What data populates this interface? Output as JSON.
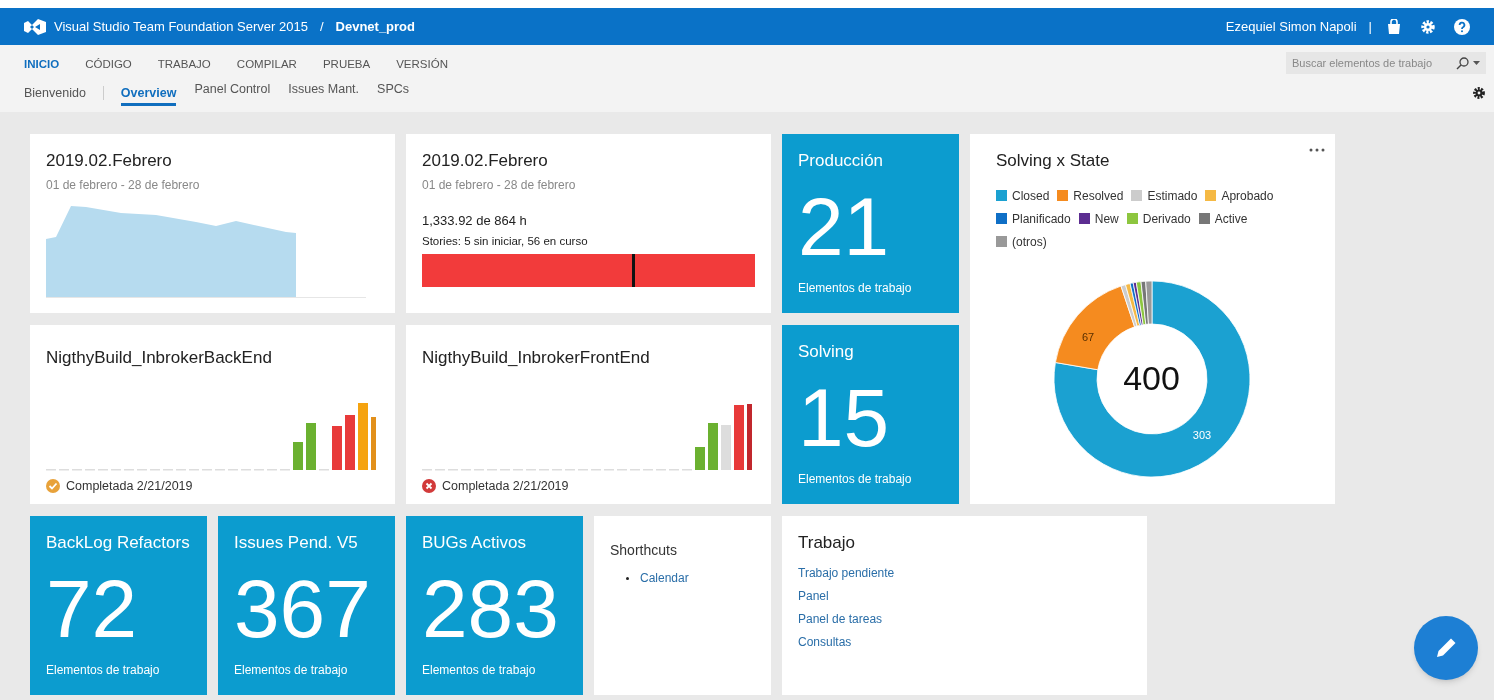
{
  "header": {
    "product": "Visual Studio Team Foundation Server 2015",
    "separator": "/",
    "project": "Devnet_prod",
    "user": "Ezequiel Simon Napoli",
    "divider": "|"
  },
  "nav": {
    "hubs": [
      {
        "label": "INICIO",
        "selected": true
      },
      {
        "label": "CÓDIGO",
        "selected": false
      },
      {
        "label": "TRABAJO",
        "selected": false
      },
      {
        "label": "COMPILAR",
        "selected": false
      },
      {
        "label": "PRUEBA",
        "selected": false
      },
      {
        "label": "VERSIÓN",
        "selected": false
      }
    ],
    "home": {
      "label": "Bienvenido"
    },
    "dashboards": [
      {
        "label": "Overview",
        "selected": true
      },
      {
        "label": "Panel Control",
        "selected": false
      },
      {
        "label": "Issues Mant.",
        "selected": false
      },
      {
        "label": "SPCs",
        "selected": false
      }
    ],
    "search": {
      "placeholder": "Buscar elementos de trabajo"
    }
  },
  "tiles": [
    {
      "kind": "burndown",
      "title": "2019.02.Febrero",
      "subtitle": "01 de febrero - 28 de febrero"
    },
    {
      "kind": "capacity",
      "title": "2019.02.Febrero",
      "subtitle": "01 de febrero - 28 de febrero",
      "hours": "1,333.92 de 864 h",
      "stories": "Stories: 5 sin iniciar, 56 en curso",
      "level": 0.63
    },
    {
      "kind": "count",
      "title": "Producción",
      "count": "21",
      "caption": "Elementos de trabajo"
    },
    {
      "kind": "donut",
      "title": "Solving x State",
      "legend": [
        {
          "label": "Closed",
          "color": "#1ba1d1"
        },
        {
          "label": "Resolved",
          "color": "#f58b1f"
        },
        {
          "label": "Estimado",
          "color": "#cccccc"
        },
        {
          "label": "Aprobado",
          "color": "#f5b944"
        },
        {
          "label": "Planificado",
          "color": "#0f6fc6"
        },
        {
          "label": "New",
          "color": "#5c2d91"
        },
        {
          "label": "Derivado",
          "color": "#8dc63f"
        },
        {
          "label": "Active",
          "color": "#777777"
        },
        {
          "label": "(otros)",
          "color": "#999999"
        }
      ],
      "total": "400",
      "slice_labels": [
        "67",
        "303"
      ]
    },
    {
      "kind": "build",
      "title": "NigthyBuild_InbrokerBackEnd",
      "result": {
        "kind": "partial",
        "text": "Completada 2/21/2019"
      }
    },
    {
      "kind": "build",
      "title": "NigthyBuild_InbrokerFrontEnd",
      "result": {
        "kind": "failed",
        "text": "Completada 2/21/2019"
      }
    },
    {
      "kind": "count",
      "title": "Solving",
      "count": "15",
      "caption": "Elementos de trabajo"
    },
    {
      "kind": "count",
      "title": "BackLog Refactors",
      "count": "72",
      "caption": "Elementos de trabajo"
    },
    {
      "kind": "count",
      "title": "Issues Pend. V5",
      "count": "367",
      "caption": "Elementos de trabajo"
    },
    {
      "kind": "count",
      "title": "BUGs Activos",
      "count": "283",
      "caption": "Elementos de trabajo"
    },
    {
      "kind": "shortcuts",
      "title": "Shorthcuts",
      "links": [
        "Calendar"
      ]
    },
    {
      "kind": "links",
      "title": "Trabajo",
      "links": [
        "Trabajo pendiente",
        "Panel",
        "Panel de tareas",
        "Consultas"
      ]
    }
  ]
}
